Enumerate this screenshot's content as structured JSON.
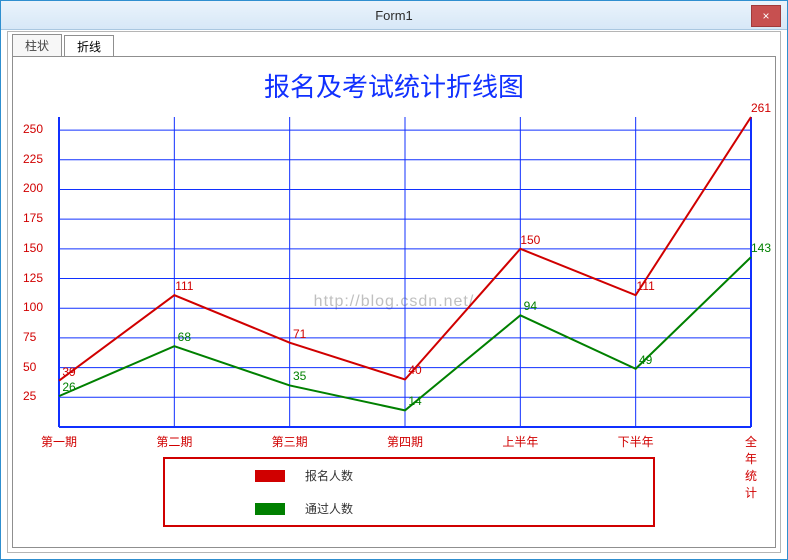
{
  "window": {
    "title": "Form1"
  },
  "tabs": {
    "bar": "柱状",
    "line": "折线"
  },
  "chart_data": {
    "type": "line",
    "title": "报名及考试统计折线图",
    "categories": [
      "第一期",
      "第二期",
      "第三期",
      "第四期",
      "上半年",
      "下半年",
      "全年统计"
    ],
    "series": [
      {
        "name": "报名人数",
        "color": "#d00000",
        "values": [
          39,
          111,
          71,
          40,
          150,
          111,
          261
        ]
      },
      {
        "name": "通过人数",
        "color": "#008000",
        "values": [
          26,
          68,
          35,
          14,
          94,
          49,
          143
        ]
      }
    ],
    "ylim": [
      0,
      250
    ],
    "ytick": 25,
    "xlabel": "",
    "ylabel": "",
    "watermark": "http://blog.csdn.net/"
  },
  "controls": {
    "close": "×"
  }
}
